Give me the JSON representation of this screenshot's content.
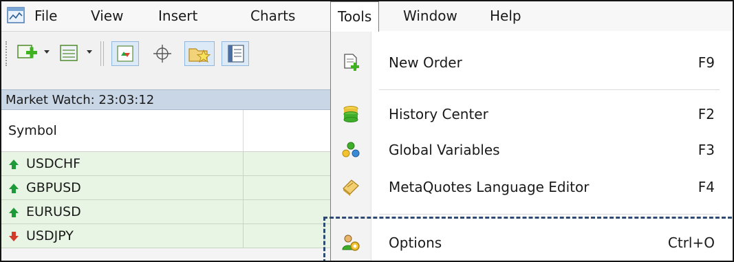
{
  "menubar": {
    "items": [
      {
        "label": "File"
      },
      {
        "label": "View"
      },
      {
        "label": "Insert"
      },
      {
        "label": "Charts"
      },
      {
        "label": "Tools"
      },
      {
        "label": "Window"
      },
      {
        "label": "Help"
      }
    ],
    "active": "Tools"
  },
  "toolbar": {
    "icons": [
      "new-chart-icon",
      "profiles-icon",
      "market-watch-icon",
      "crosshair-icon",
      "navigator-icon",
      "data-window-icon"
    ]
  },
  "market_watch": {
    "title": "Market Watch: 23:03:12",
    "columns": [
      "Symbol",
      ""
    ],
    "rows": [
      {
        "symbol": "USDCHF",
        "direction": "up"
      },
      {
        "symbol": "GBPUSD",
        "direction": "up"
      },
      {
        "symbol": "EURUSD",
        "direction": "up"
      },
      {
        "symbol": "USDJPY",
        "direction": "down"
      }
    ]
  },
  "tools_menu": {
    "items": [
      {
        "label": "New Order",
        "shortcut": "F9",
        "icon": "new-order-icon"
      },
      {
        "label": "History Center",
        "shortcut": "F2",
        "icon": "history-center-icon"
      },
      {
        "label": "Global Variables",
        "shortcut": "F3",
        "icon": "global-variables-icon"
      },
      {
        "label": "MetaQuotes Language Editor",
        "shortcut": "F4",
        "icon": "metaeditor-icon"
      },
      {
        "label": "Options",
        "shortcut": "Ctrl+O",
        "icon": "options-icon"
      }
    ]
  },
  "colors": {
    "row_bg": "#e8f5e4",
    "header_bg": "#c9d6e6",
    "up_arrow": "#1e9a3a",
    "focus_dash": "#2e4a73"
  }
}
